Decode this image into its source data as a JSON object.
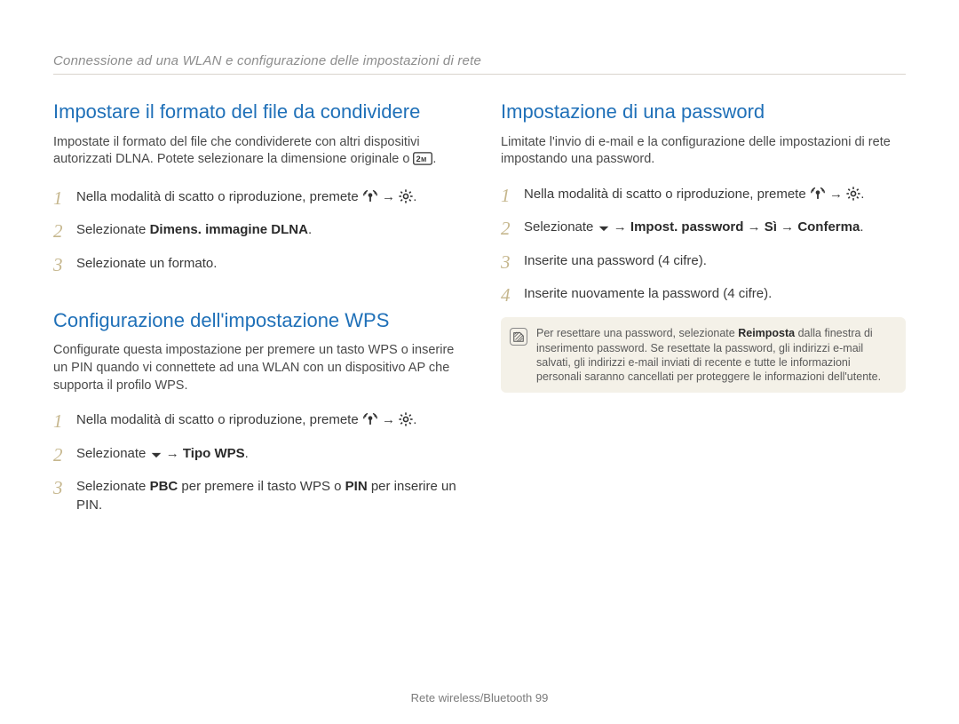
{
  "breadcrumb": "Connessione ad una WLAN e configurazione delle impostazioni di rete",
  "left": {
    "sec1": {
      "title": "Impostare il formato del file da condividere",
      "para_a": "Impostate il formato del file che condividerete con altri dispositivi autorizzati DLNA. Potete selezionare la dimensione originale o ",
      "para_b": ".",
      "steps": {
        "s1a": "Nella modalità di scatto o riproduzione, premete ",
        "s1b": " → ",
        "s1c": ".",
        "s2a": "Selezionate ",
        "s2b": "Dimens. immagine DLNA",
        "s2c": ".",
        "s3": "Selezionate un formato."
      }
    },
    "sec2": {
      "title": "Configurazione dell'impostazione WPS",
      "para": "Configurate questa impostazione per premere un tasto WPS o inserire un PIN quando vi connettete ad una WLAN con un dispositivo AP che supporta il profilo WPS.",
      "steps": {
        "s1a": "Nella modalità di scatto o riproduzione, premete ",
        "s1b": " → ",
        "s1c": ".",
        "s2a": "Selezionate ",
        "s2b": " → ",
        "s2c": "Tipo WPS",
        "s2d": ".",
        "s3a": "Selezionate ",
        "s3b": "PBC",
        "s3c": " per premere il tasto WPS o ",
        "s3d": "PIN",
        "s3e": " per inserire un PIN."
      }
    }
  },
  "right": {
    "sec1": {
      "title": "Impostazione di una password",
      "para": "Limitate l'invio di e-mail e la configurazione delle impostazioni di rete impostando una password.",
      "steps": {
        "s1a": "Nella modalità di scatto o riproduzione, premete ",
        "s1b": " → ",
        "s1c": ".",
        "s2a": "Selezionate ",
        "s2b": " → ",
        "s2c": "Impost. password",
        "s2d": " → ",
        "s2e": "Sì",
        "s2f": " → ",
        "s2g": "Conferma",
        "s2h": ".",
        "s3": "Inserite una password (4 cifre).",
        "s4": "Inserite nuovamente la password (4 cifre)."
      },
      "note_a": "Per resettare una password, selezionate ",
      "note_b": "Reimposta",
      "note_c": " dalla finestra di inserimento password. Se resettate la password, gli indirizzi e-mail salvati, gli indirizzi e-mail inviati di recente e tutte le informazioni personali saranno cancellati per proteggere le informazioni dell'utente."
    }
  },
  "footer_a": "Rete wireless/Bluetooth",
  "footer_b": "  99",
  "nums": {
    "n1": "1",
    "n2": "2",
    "n3": "3",
    "n4": "4"
  }
}
